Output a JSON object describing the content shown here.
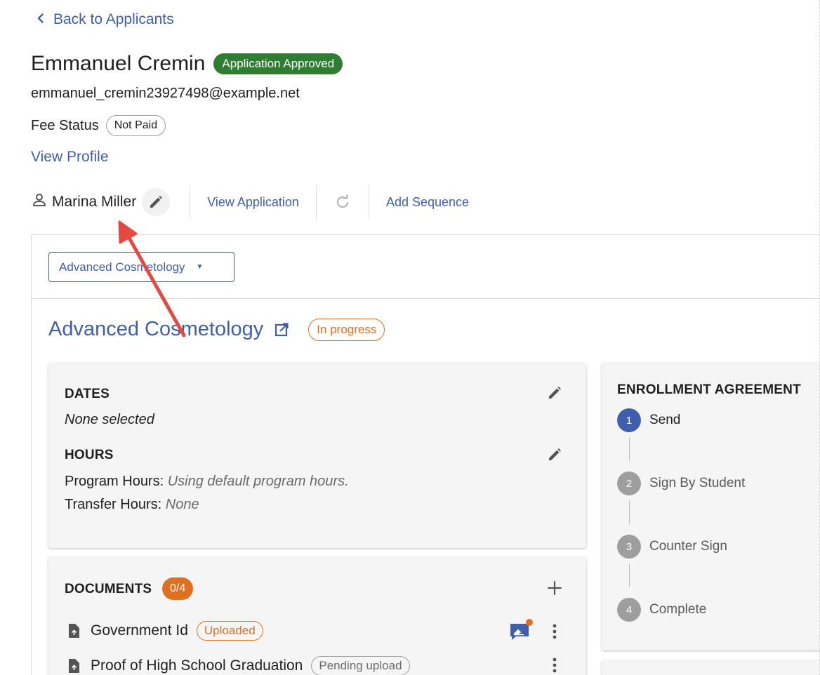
{
  "nav": {
    "back_label": "Back to Applicants"
  },
  "applicant": {
    "name": "Emmanuel Cremin",
    "status_badge": "Application Approved",
    "email": "emmanuel_cremin23927498@example.net",
    "fee_label": "Fee Status",
    "fee_status": "Not Paid",
    "view_profile": "View Profile"
  },
  "actions": {
    "assignee": "Marina Miller",
    "view_application": "View Application",
    "add_sequence": "Add Sequence"
  },
  "program_select": {
    "value": "Advanced Cosmetology"
  },
  "program": {
    "title": "Advanced Cosmetology",
    "status": "In progress"
  },
  "dates": {
    "title": "DATES",
    "value": "None selected"
  },
  "hours": {
    "title": "HOURS",
    "program_hours_label": "Program Hours:",
    "program_hours_value": "Using default program hours.",
    "transfer_hours_label": "Transfer Hours:",
    "transfer_hours_value": "None"
  },
  "documents": {
    "title": "DOCUMENTS",
    "count": "0/4",
    "items": [
      {
        "name": "Government Id",
        "status": "Uploaded"
      },
      {
        "name": "Proof of High School Graduation",
        "status": "Pending upload"
      }
    ]
  },
  "enrollment": {
    "title": "ENROLLMENT AGREEMENT",
    "steps": [
      {
        "num": "1",
        "label": "Send"
      },
      {
        "num": "2",
        "label": "Sign By Student"
      },
      {
        "num": "3",
        "label": "Counter Sign"
      },
      {
        "num": "4",
        "label": "Complete"
      }
    ]
  },
  "colors": {
    "link_blue": "#3f5fad",
    "approved_green": "#2e7d32",
    "progress_orange": "#e0701f",
    "annotation_red": "#e5483f"
  },
  "icons": [
    "chevron-left-icon",
    "person-icon",
    "pencil-icon",
    "refresh-icon",
    "external-link-icon",
    "plus-icon",
    "file-upload-icon",
    "signature-icon",
    "more-vertical-icon",
    "caret-down-icon"
  ]
}
